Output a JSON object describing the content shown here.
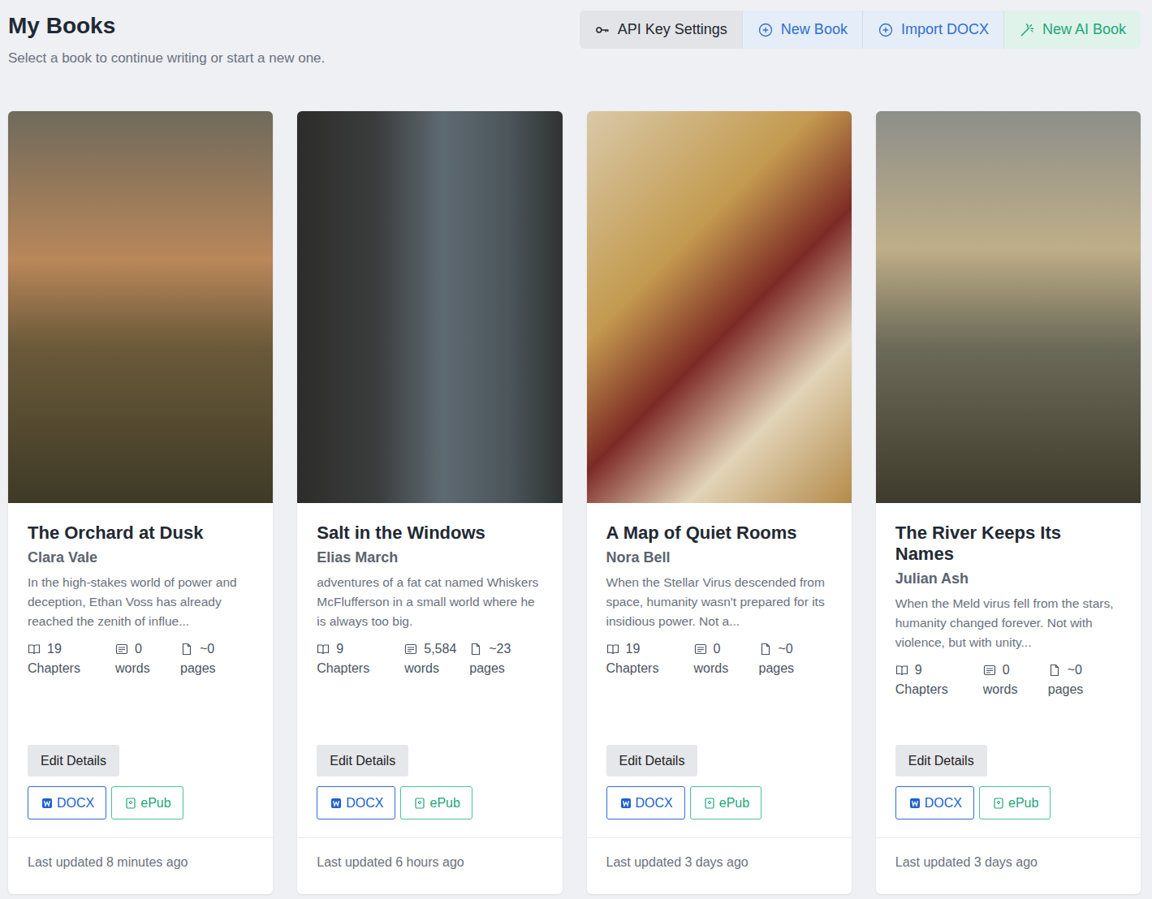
{
  "header": {
    "title": "My Books",
    "subtitle": "Select a book to continue writing or start a new one."
  },
  "toolbar": [
    {
      "label": "API Key Settings",
      "kind": "settings"
    },
    {
      "label": "New Book",
      "kind": "new"
    },
    {
      "label": "Import DOCX",
      "kind": "import"
    },
    {
      "label": "New AI Book",
      "kind": "ai"
    }
  ],
  "card_actions": {
    "edit": "Edit Details",
    "docx": "DOCX",
    "epub": "ePub"
  },
  "books": [
    {
      "title": "The Orchard at Dusk",
      "author": "Clara Vale",
      "description": "In the high-stakes world of power and deception, Ethan Voss has already reached the zenith of influe...",
      "stats": [
        {
          "kind": "chapters",
          "value": "19",
          "label": "Chapters"
        },
        {
          "kind": "words",
          "value": "0",
          "label": "words"
        },
        {
          "kind": "pages",
          "value": "~0",
          "label": "pages"
        }
      ],
      "updated": "Last updated 8 minutes ago"
    },
    {
      "title": "Salt in the Windows",
      "author": "Elias March",
      "description": "adventures of a fat cat named Whiskers McFlufferson in a small world where he is always too big.",
      "stats": [
        {
          "kind": "chapters",
          "value": "9",
          "label": "Chapters"
        },
        {
          "kind": "words",
          "value": "5,584",
          "label": "words"
        },
        {
          "kind": "pages",
          "value": "~23",
          "label": "pages"
        }
      ],
      "updated": "Last updated 6 hours ago"
    },
    {
      "title": "A Map of Quiet Rooms",
      "author": "Nora Bell",
      "description": "When the Stellar Virus descended from space, humanity wasn't prepared for its insidious power. Not a...",
      "stats": [
        {
          "kind": "chapters",
          "value": "19",
          "label": "Chapters"
        },
        {
          "kind": "words",
          "value": "0",
          "label": "words"
        },
        {
          "kind": "pages",
          "value": "~0",
          "label": "pages"
        }
      ],
      "updated": "Last updated 3 days ago"
    },
    {
      "title": "The River Keeps Its Names",
      "author": "Julian Ash",
      "description": "When the Meld virus fell from the stars, humanity changed forever. Not with violence, but with unity...",
      "stats": [
        {
          "kind": "chapters",
          "value": "9",
          "label": "Chapters"
        },
        {
          "kind": "words",
          "value": "0",
          "label": "words"
        },
        {
          "kind": "pages",
          "value": "~0",
          "label": "pages"
        }
      ],
      "updated": "Last updated 3 days ago"
    }
  ]
}
